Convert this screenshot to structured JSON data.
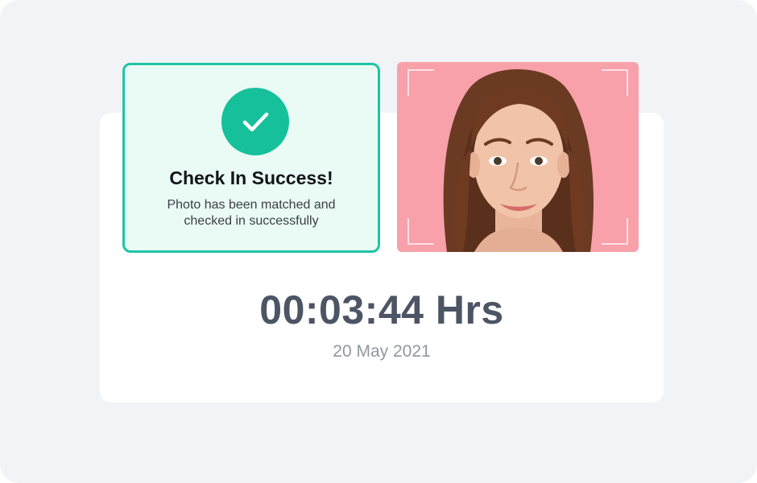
{
  "checkin": {
    "status_icon": "checkmark-icon",
    "title": "Check In Success!",
    "description": "Photo has been matched and checked in successfully"
  },
  "photo": {
    "subject": "face-photo",
    "background_color": "#f8a1aa",
    "frame_icon": "face-scan-frame-icon"
  },
  "session": {
    "elapsed": "00:03:44 Hrs",
    "date": "20 May 2021"
  },
  "colors": {
    "accent": "#16c09b",
    "accent_border": "#1fc4a4",
    "success_bg": "#e9fbf4",
    "page_bg": "#f1f3f7",
    "timer_text": "#4c5564",
    "date_text": "#9197a1"
  }
}
